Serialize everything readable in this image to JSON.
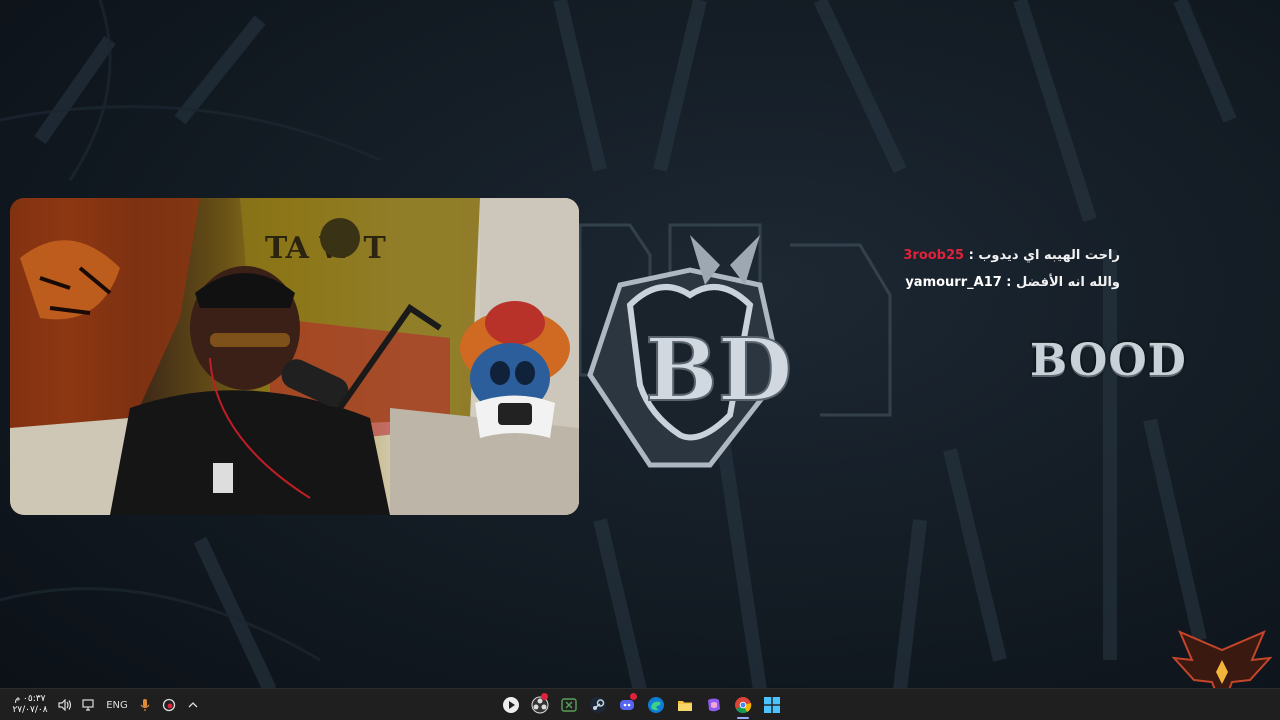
{
  "chat": {
    "messages": [
      {
        "user": "3roob25",
        "separator": " : ",
        "text": "راحت الهيبه اي ديدوب",
        "user_color": "#e0223a"
      },
      {
        "user": "yamourr_A17",
        "separator": " : ",
        "text": "والله انه الأفضل",
        "user_color": "#ffffff"
      }
    ]
  },
  "overlay": {
    "logo_text": "BOOD"
  },
  "taskbar": {
    "clock_time": "٠٥:٣٧ م",
    "clock_date": "٢٧/٠٧/٠٨",
    "language": "ENG",
    "apps": [
      {
        "name": "media-player-icon"
      },
      {
        "name": "obs-icon"
      },
      {
        "name": "xbox-icon"
      },
      {
        "name": "steam-icon"
      },
      {
        "name": "discord-icon"
      },
      {
        "name": "edge-icon"
      },
      {
        "name": "file-explorer-icon"
      },
      {
        "name": "copilot-icon"
      },
      {
        "name": "chrome-icon"
      },
      {
        "name": "windows-start-icon"
      }
    ]
  },
  "colors": {
    "accent_red": "#e0223a",
    "taskbar_bg": "#1f1f1f",
    "background": "#121a22"
  }
}
